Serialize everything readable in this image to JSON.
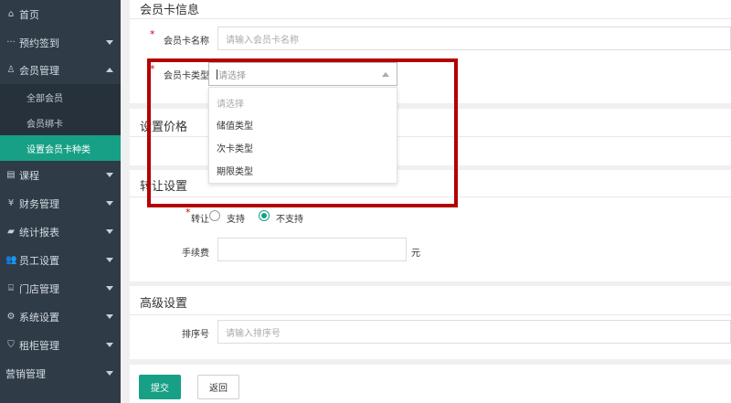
{
  "sidebar": {
    "items": [
      {
        "icon": "home-icon",
        "glyph": "⌂",
        "label": "首页",
        "caret": "none"
      },
      {
        "icon": "dots-icon",
        "glyph": "···",
        "label": "预约签到",
        "caret": "down"
      },
      {
        "icon": "user-icon",
        "glyph": "♙",
        "label": "会员管理",
        "caret": "up"
      },
      {
        "icon": "book-icon",
        "glyph": "▤",
        "label": "课程",
        "caret": "down"
      },
      {
        "icon": "yen-icon",
        "glyph": "¥",
        "label": "财务管理",
        "caret": "down"
      },
      {
        "icon": "chart-icon",
        "glyph": "▰",
        "label": "统计报表",
        "caret": "down"
      },
      {
        "icon": "staff-icon",
        "glyph": "👥",
        "label": "员工设置",
        "caret": "down"
      },
      {
        "icon": "store-icon",
        "glyph": "⌸",
        "label": "门店管理",
        "caret": "down"
      },
      {
        "icon": "gear-icon",
        "glyph": "⚙",
        "label": "系统设置",
        "caret": "down"
      },
      {
        "icon": "locker-icon",
        "glyph": "⛉",
        "label": "租柜管理",
        "caret": "down"
      },
      {
        "icon": "marketing-icon",
        "glyph": "",
        "label": "营销管理",
        "caret": "down"
      }
    ],
    "sub_items": [
      {
        "label": "全部会员",
        "active": false
      },
      {
        "label": "会员绑卡",
        "active": false
      },
      {
        "label": "设置会员卡种类",
        "active": true
      }
    ]
  },
  "form": {
    "section_card_info": "会员卡信息",
    "card_name_label": "会员卡名称",
    "card_name_placeholder": "请输入会员卡名称",
    "card_type_label": "会员卡类型",
    "card_type_placeholder": "请选择",
    "card_type_options": [
      "请选择",
      "储值类型",
      "次卡类型",
      "期限类型"
    ],
    "section_price": "设置价格",
    "section_transfer": "转让设置",
    "transfer_label": "转让",
    "transfer_yes": "支持",
    "transfer_no": "不支持",
    "transfer_selected": "不支持",
    "fee_label": "手续费",
    "fee_unit": "元",
    "section_advanced": "高级设置",
    "sort_label": "排序号",
    "sort_placeholder": "请输入排序号",
    "submit_label": "提交",
    "back_label": "返回"
  },
  "colors": {
    "sidebar_bg": "#2f3b47",
    "accent": "#17a085",
    "highlight_border": "#b30000",
    "required": "#d9001b"
  }
}
